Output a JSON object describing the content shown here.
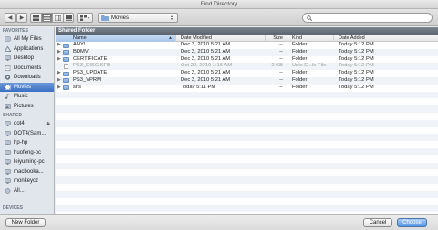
{
  "window": {
    "title": "Find Directory"
  },
  "toolbar": {
    "location": "Movies",
    "search_placeholder": ""
  },
  "sidebar": {
    "favorites_header": "FAVORITES",
    "favorites": [
      {
        "label": "All My Files",
        "icon": "all-files-icon"
      },
      {
        "label": "Applications",
        "icon": "applications-icon"
      },
      {
        "label": "Desktop",
        "icon": "desktop-icon"
      },
      {
        "label": "Documents",
        "icon": "documents-icon"
      },
      {
        "label": "Downloads",
        "icon": "downloads-icon"
      },
      {
        "label": "Movies",
        "icon": "movies-icon",
        "selected": true
      },
      {
        "label": "Music",
        "icon": "music-icon"
      },
      {
        "label": "Pictures",
        "icon": "pictures-icon"
      }
    ],
    "shared_header": "SHARED",
    "shared": [
      {
        "label": "dot4",
        "eject": true
      },
      {
        "label": "DOT4(Sam..."
      },
      {
        "label": "hp-hp"
      },
      {
        "label": "huofeng-pc"
      },
      {
        "label": "leiyuming-pc"
      },
      {
        "label": "macbooka..."
      },
      {
        "label": "monkeycz"
      },
      {
        "label": "All..."
      }
    ],
    "devices_header": "DEVICES"
  },
  "main": {
    "section_title": "Shared Folder",
    "columns": {
      "name": "Name",
      "date_modified": "Date Modified",
      "size": "Size",
      "kind": "Kind",
      "date_added": "Date Added"
    },
    "files": [
      {
        "name": "ANY!",
        "date_modified": "Dec 2, 2010 5:21 AM",
        "size": "--",
        "kind": "Folder",
        "date_added": "Today 5:12 PM",
        "type": "folder",
        "dim": false
      },
      {
        "name": "BDMV",
        "date_modified": "Dec 2, 2010 5:21 AM",
        "size": "--",
        "kind": "Folder",
        "date_added": "Today 5:12 PM",
        "type": "folder",
        "dim": false
      },
      {
        "name": "CERTIFICATE",
        "date_modified": "Dec 2, 2010 5:21 AM",
        "size": "--",
        "kind": "Folder",
        "date_added": "Today 5:12 PM",
        "type": "folder",
        "dim": false
      },
      {
        "name": "PS3_DISC.SFB",
        "date_modified": "Oct 20, 2010 1:16 AM",
        "size": "2 KB",
        "kind": "Unix E...le File",
        "date_added": "Today 5:12 PM",
        "type": "file",
        "dim": true
      },
      {
        "name": "PS3_UPDATE",
        "date_modified": "Dec 2, 2010 5:21 AM",
        "size": "--",
        "kind": "Folder",
        "date_added": "Today 5:12 PM",
        "type": "folder",
        "dim": false
      },
      {
        "name": "PS3_VPRM",
        "date_modified": "Dec 2, 2010 5:21 AM",
        "size": "--",
        "kind": "Folder",
        "date_added": "Today 5:12 PM",
        "type": "folder",
        "dim": false
      },
      {
        "name": "sns",
        "date_modified": "Today 5:11 PM",
        "size": "--",
        "kind": "Folder",
        "date_added": "Today 5:12 PM",
        "type": "folder",
        "dim": false
      }
    ]
  },
  "footer": {
    "new_folder": "New Folder",
    "cancel": "Cancel",
    "choose": "Choose"
  },
  "colors": {
    "selection": "#3a6fc3",
    "sidebar_bg": "#e1e6ed",
    "primary_button": "#4e92e6"
  }
}
